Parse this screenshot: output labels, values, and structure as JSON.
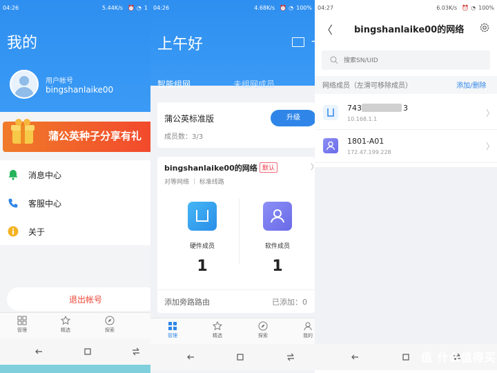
{
  "colors": {
    "primary": "#2f8ff0",
    "danger": "#ee4433",
    "accent_blue": "#2f86e8"
  },
  "panel1": {
    "status": {
      "time": "04:26",
      "speed": "5.44K/s",
      "battery": "1"
    },
    "title": "我的",
    "account_label": "用户帐号",
    "account_name": "bingshanlaike00",
    "banner_text": "蒲公英种子分享有礼",
    "menu": [
      {
        "label": "消息中心",
        "icon": "bell-icon"
      },
      {
        "label": "客服中心",
        "icon": "phone-icon"
      },
      {
        "label": "关于",
        "icon": "info-icon"
      }
    ],
    "logout": "退出帐号",
    "tabs": [
      {
        "label": "管理",
        "icon": "grid-icon"
      },
      {
        "label": "精选",
        "icon": "star-icon"
      },
      {
        "label": "探索",
        "icon": "compass-icon"
      }
    ]
  },
  "panel2": {
    "status": {
      "time": "04:26",
      "speed": "4.68K/s",
      "battery": "100%"
    },
    "greeting": "上午好",
    "tab_active": "智能组网",
    "tab_inactive": "未组网成员",
    "plan_name": "蒲公英标准版",
    "upgrade": "升级",
    "member_count": "成员数：3/3",
    "network_name": "bingshanlaike00的网络",
    "default_tag": "默认",
    "network_sub": "对等网络  ｜  标准线路",
    "hardware_label": "硬件成员",
    "hardware_count": "1",
    "software_label": "软件成员",
    "software_count": "1",
    "bypass": "添加旁路路由",
    "added": "已添加：0",
    "tabs": [
      {
        "label": "管理",
        "icon": "grid-icon"
      },
      {
        "label": "精选",
        "icon": "star-icon"
      },
      {
        "label": "探索",
        "icon": "compass-icon"
      },
      {
        "label": "我的",
        "icon": "person-icon"
      }
    ]
  },
  "panel3": {
    "status": {
      "time": "04:27",
      "speed": "6.03K/s",
      "battery": "100%"
    },
    "title": "bingshanlaike00的网络",
    "search_placeholder": "搜索SN/UID",
    "section_label": "网络成员（左滑可移除成员）",
    "section_action": "添加/删除",
    "members": [
      {
        "name_prefix": "743",
        "name_suffix": "3",
        "ip": "10.168.1.1",
        "icon": "router-icon"
      },
      {
        "name": "1801-A01",
        "ip": "172.47.199.228",
        "icon": "person-icon"
      }
    ]
  },
  "watermark": "值 什么值得买"
}
